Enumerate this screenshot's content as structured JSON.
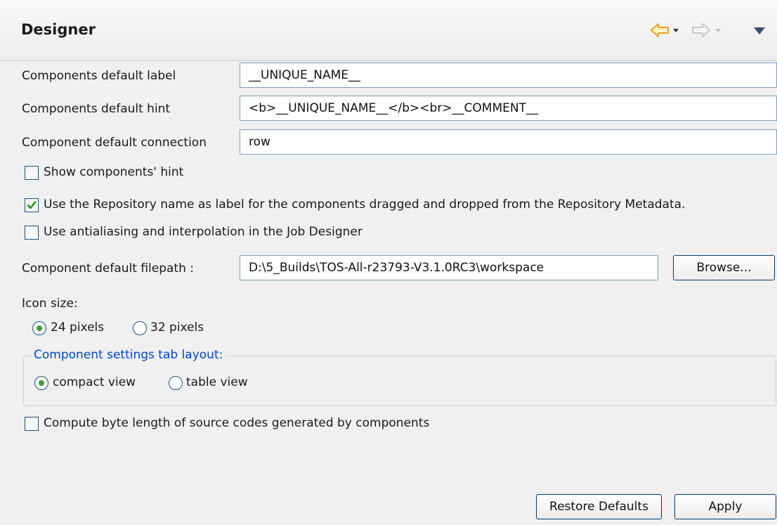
{
  "header": {
    "title": "Designer",
    "back_icon": "back-arrow-icon",
    "back_menu_icon": "dropdown-small-icon",
    "forward_icon": "forward-arrow-icon",
    "forward_menu_icon": "dropdown-small-icon",
    "view_menu_icon": "view-menu-icon"
  },
  "form": {
    "default_label": {
      "label": "Components default label",
      "value": "__UNIQUE_NAME__"
    },
    "default_hint": {
      "label": "Components default hint",
      "value": "<b>__UNIQUE_NAME__</b><br>__COMMENT__"
    },
    "default_connection": {
      "label": "Component default connection",
      "value": "row"
    },
    "show_hint": {
      "label": "Show components' hint",
      "checked": false
    },
    "use_repo_name": {
      "label": "Use the Repository name as label for the components dragged and dropped from the Repository Metadata.",
      "checked": true
    },
    "antialiasing": {
      "label": "Use antialiasing and interpolation in the Job Designer",
      "checked": false
    },
    "filepath": {
      "label": "Component default filepath :",
      "value": "D:\\5_Builds\\TOS-All-r23793-V3.1.0RC3\\workspace",
      "browse_label": "Browse..."
    },
    "icon_size": {
      "label": "Icon size:",
      "options": [
        "24 pixels",
        "32 pixels"
      ],
      "selected": "24 pixels"
    },
    "tab_layout": {
      "title": "Component settings tab layout:",
      "options": [
        "compact view",
        "table view"
      ],
      "selected": "compact view"
    },
    "byte_length": {
      "label": "Compute byte length of source codes generated by components",
      "checked": false
    }
  },
  "footer": {
    "restore_label": "Restore Defaults",
    "apply_label": "Apply"
  },
  "colors": {
    "accent_arrow": "#e8a21c",
    "group_title": "#0046d5",
    "check": "#1f9a1f"
  }
}
